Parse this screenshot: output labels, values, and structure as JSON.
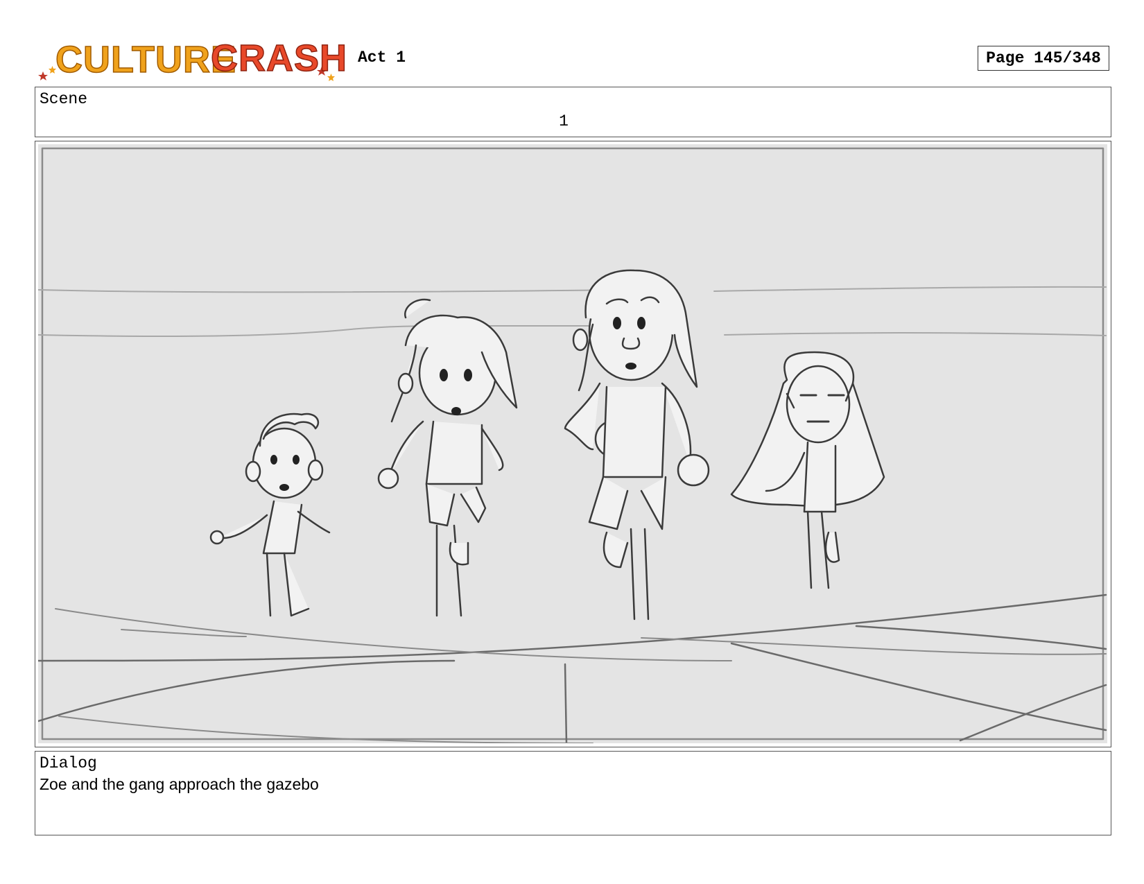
{
  "header": {
    "logo_text": "CULTURE CRASH",
    "act": "Act 1",
    "page": "Page 145/348"
  },
  "scene": {
    "label": "Scene",
    "number": "1"
  },
  "dialog": {
    "label": "Dialog",
    "text": "Zoe and the gang approach the gazebo"
  },
  "colors": {
    "logo_culture": "#f0a21c",
    "logo_crash": "#e8492a",
    "panel_bg": "#e4e4e4"
  }
}
